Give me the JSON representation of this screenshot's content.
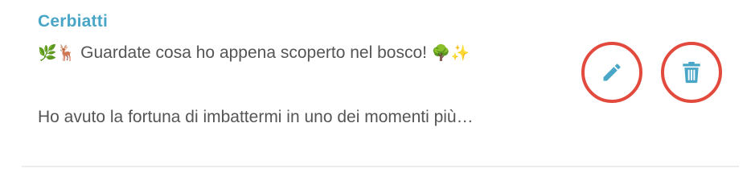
{
  "post": {
    "title": "Cerbiatti",
    "line1": {
      "emoji_start": "🌿🦌",
      "text": " Guardate cosa ho appena scoperto nel bosco! ",
      "emoji_end": "🌳✨"
    },
    "line2": "Ho avuto la fortuna di imbattermi in uno dei momenti più…"
  },
  "actions": {
    "edit_icon": "pencil-icon",
    "delete_icon": "trash-icon",
    "icon_color": "#4aa6c6",
    "ring_color": "#e14a3c"
  }
}
